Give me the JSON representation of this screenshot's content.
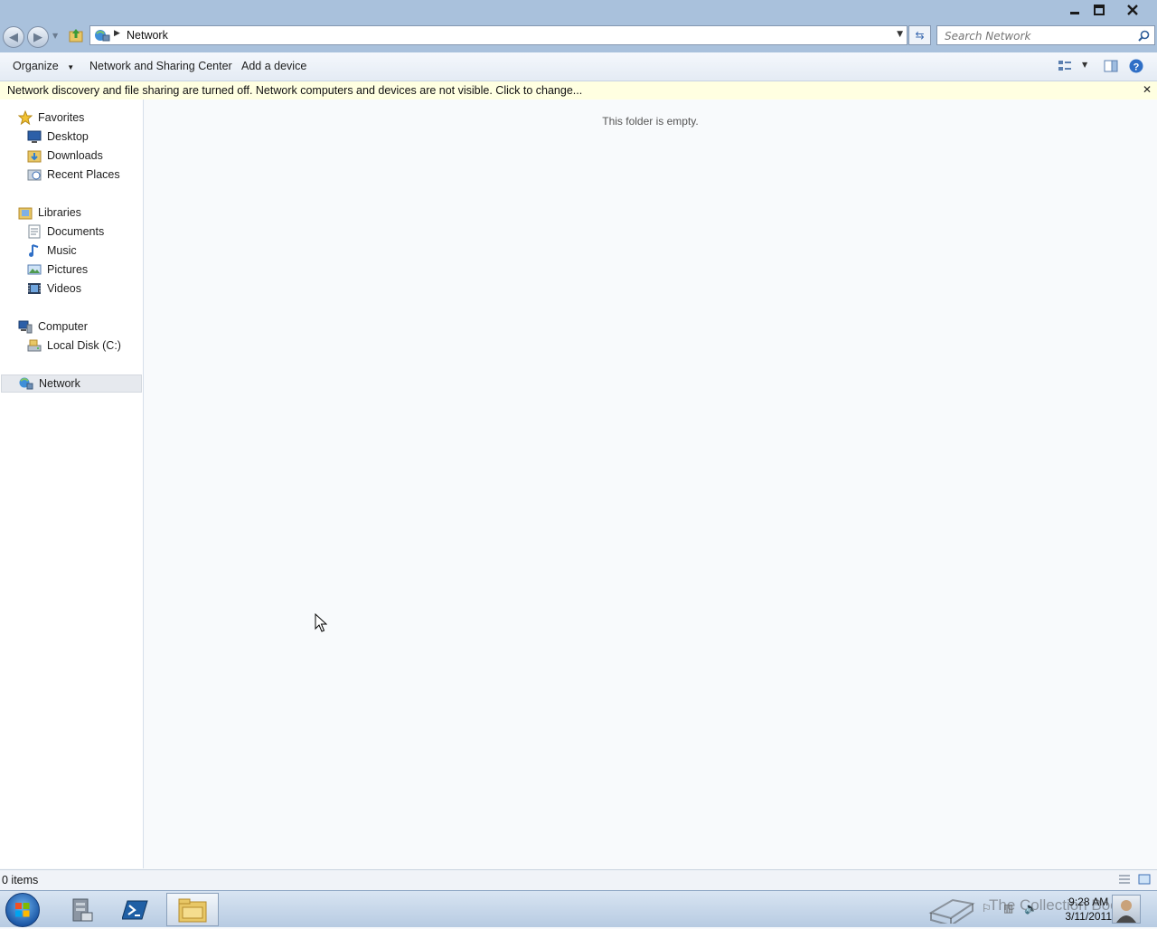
{
  "window": {
    "minimize_icon": "minimize-icon",
    "maximize_icon": "maximize-icon",
    "close_icon": "close-icon"
  },
  "address_bar": {
    "location_icon": "network-icon",
    "path": "Network",
    "search_placeholder": "Search Network"
  },
  "toolbar": {
    "organize_label": "Organize",
    "network_sharing_label": "Network and Sharing Center",
    "add_device_label": "Add a device"
  },
  "info_bar": {
    "message": "Network discovery and file sharing are turned off. Network computers and devices are not visible. Click to change..."
  },
  "navigation": {
    "favorites": {
      "label": "Favorites",
      "items": [
        {
          "label": "Desktop"
        },
        {
          "label": "Downloads"
        },
        {
          "label": "Recent Places"
        }
      ]
    },
    "libraries": {
      "label": "Libraries",
      "items": [
        {
          "label": "Documents"
        },
        {
          "label": "Music"
        },
        {
          "label": "Pictures"
        },
        {
          "label": "Videos"
        }
      ]
    },
    "computer": {
      "label": "Computer",
      "items": [
        {
          "label": "Local Disk (C:)"
        }
      ]
    },
    "network": {
      "label": "Network",
      "selected": true
    }
  },
  "content": {
    "empty_message": "This folder is empty."
  },
  "status_bar": {
    "item_count": "0 items"
  },
  "taskbar": {
    "clock_time": "9:28 AM",
    "clock_date": "3/11/2011",
    "watermark": "The Collection Book",
    "accent": "#1e5aa8"
  }
}
